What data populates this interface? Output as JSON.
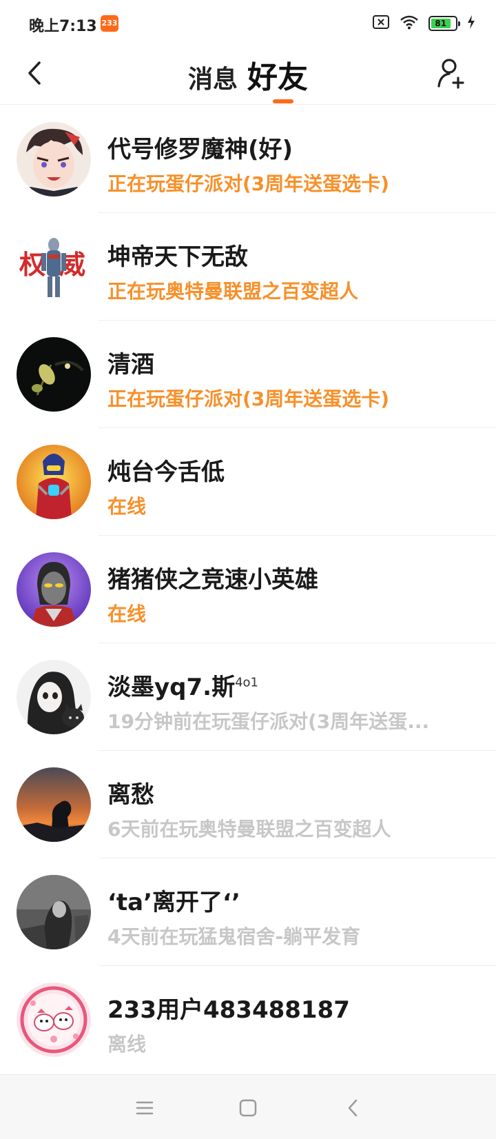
{
  "status_bar": {
    "time": "晚上7:13",
    "app_badge": "233",
    "battery_level": "81",
    "icons": [
      "sim-off-icon",
      "wifi-icon",
      "battery-icon",
      "charging-icon"
    ]
  },
  "header": {
    "tabs": [
      {
        "label": "消息",
        "active": false
      },
      {
        "label": "好友",
        "active": true
      }
    ],
    "accent_color": "#ff6a1a"
  },
  "friends": [
    {
      "name": "代号修罗魔神(好)",
      "sup": "",
      "status": "正在玩蛋仔派对(3周年送蛋选卡)",
      "status_type": "active"
    },
    {
      "name": "坤帝天下无敌",
      "sup": "",
      "status": "正在玩奥特曼联盟之百变超人",
      "status_type": "active"
    },
    {
      "name": "清酒",
      "sup": "",
      "status": "正在玩蛋仔派对(3周年送蛋选卡)",
      "status_type": "active"
    },
    {
      "name": "炖台今舌低",
      "sup": "",
      "status": "在线",
      "status_type": "active"
    },
    {
      "name": "猪猪侠之竞速小英雄",
      "sup": "",
      "status": "在线",
      "status_type": "active"
    },
    {
      "name": "淡墨yq7.斯",
      "sup": "4o1",
      "status": "19分钟前在玩蛋仔派对(3周年送蛋...",
      "status_type": "idle"
    },
    {
      "name": "离愁",
      "sup": "",
      "status": "6天前在玩奥特曼联盟之百变超人",
      "status_type": "idle"
    },
    {
      "name": "‘ta’离开了‘’",
      "sup": "",
      "status": "4天前在玩猛鬼宿舍-躺平发育",
      "status_type": "idle"
    },
    {
      "name": "233用户483488187",
      "sup": "",
      "status": "离线",
      "status_type": "idle"
    }
  ],
  "colors": {
    "active_status": "#f7902a",
    "idle_status": "#c7c7c7"
  }
}
